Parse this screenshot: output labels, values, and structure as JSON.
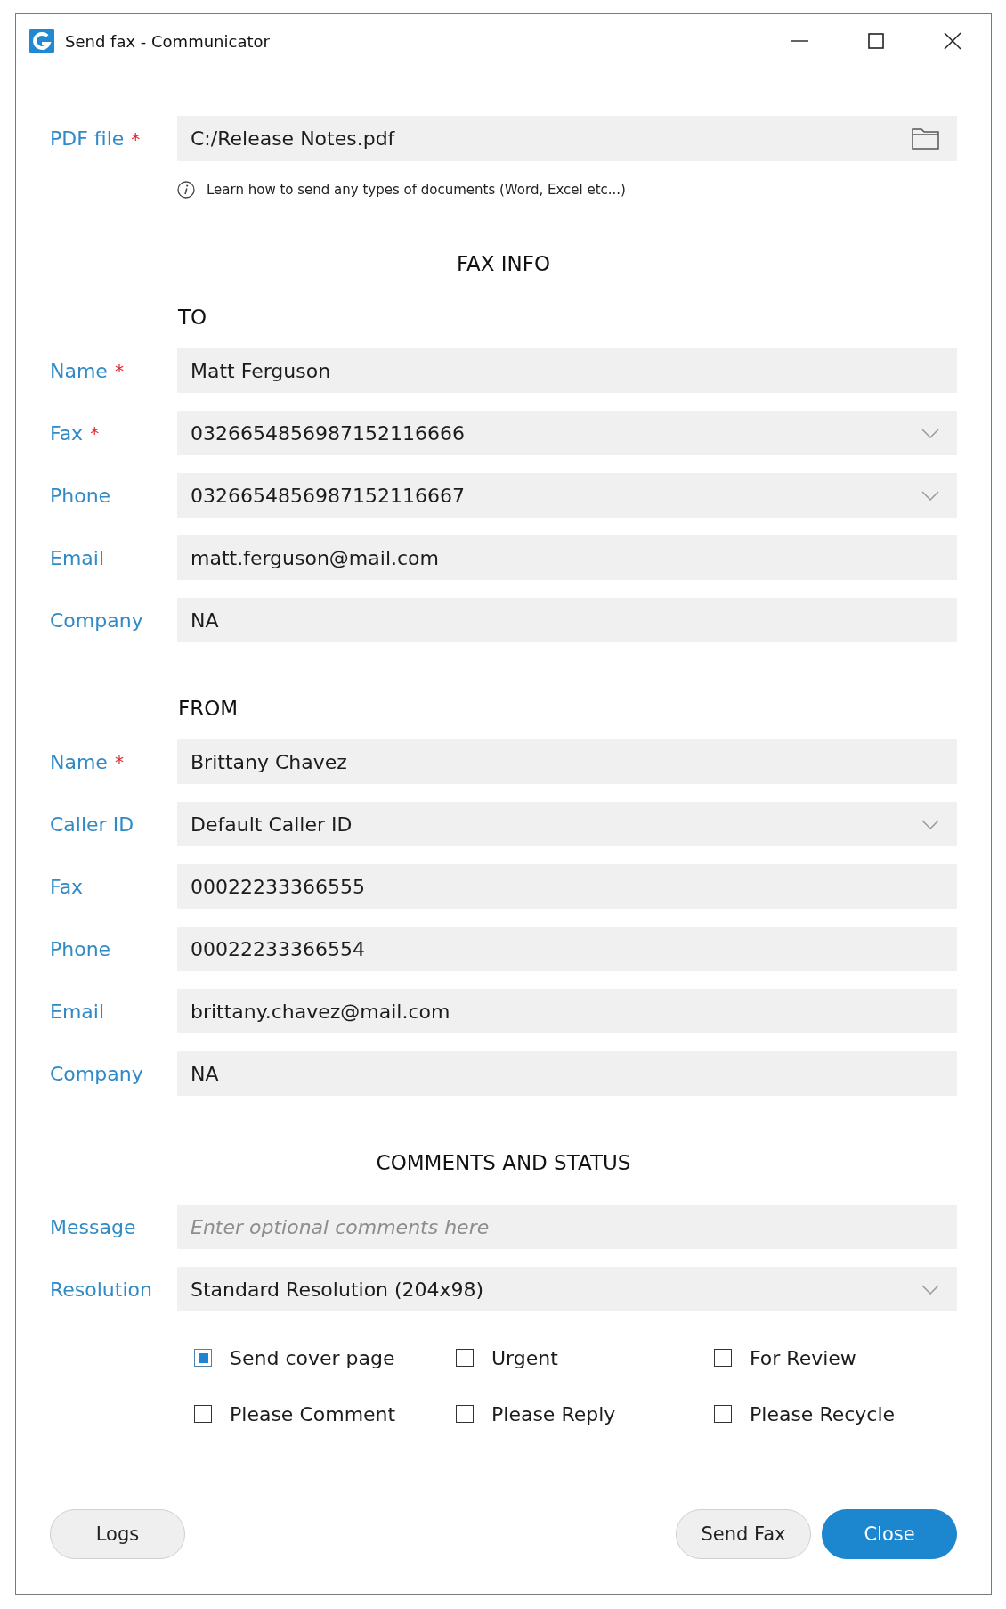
{
  "window": {
    "title": "Send fax - Communicator"
  },
  "pdf_file": {
    "label": "PDF file",
    "required_mark": "*",
    "kind": "file",
    "value": "C:/Release Notes.pdf",
    "help_text": "Learn how to send any types of documents (Word, Excel etc...)"
  },
  "fax_info": {
    "heading": "FAX INFO",
    "groups": [
      {
        "heading": "TO",
        "fields": [
          {
            "label": "Name",
            "required_mark": "*",
            "kind": "text",
            "value": "Matt Ferguson"
          },
          {
            "label": "Fax",
            "required_mark": "*",
            "kind": "dropdown",
            "value": "0326654856987152116666"
          },
          {
            "label": "Phone",
            "kind": "dropdown",
            "value": "0326654856987152116667"
          },
          {
            "label": "Email",
            "kind": "text",
            "value": "matt.ferguson@mail.com"
          },
          {
            "label": "Company",
            "kind": "text",
            "value": "NA"
          }
        ]
      },
      {
        "heading": "FROM",
        "fields": [
          {
            "label": "Name",
            "required_mark": "*",
            "kind": "text",
            "value": "Brittany Chavez"
          },
          {
            "label": "Caller ID",
            "kind": "dropdown",
            "value": "Default Caller ID"
          },
          {
            "label": "Fax",
            "kind": "text",
            "value": "00022233366555"
          },
          {
            "label": "Phone",
            "kind": "text",
            "value": "00022233366554"
          },
          {
            "label": "Email",
            "kind": "text",
            "value": "brittany.chavez@mail.com"
          },
          {
            "label": "Company",
            "kind": "text",
            "value": "NA"
          }
        ]
      }
    ]
  },
  "comments_and_status": {
    "heading": "COMMENTS AND STATUS",
    "fields": [
      {
        "label": "Message",
        "kind": "text",
        "placeholder": "Enter optional comments here"
      },
      {
        "label": "Resolution",
        "kind": "dropdown",
        "value": "Standard Resolution (204x98)"
      }
    ],
    "options": [
      {
        "label": "Send cover page",
        "checked": true
      },
      {
        "label": "Urgent",
        "checked": false
      },
      {
        "label": "For Review",
        "checked": false
      },
      {
        "label": "Please Comment",
        "checked": false
      },
      {
        "label": "Please Reply",
        "checked": false
      },
      {
        "label": "Please Recycle",
        "checked": false
      }
    ]
  },
  "buttons": [
    {
      "label": "Logs",
      "kind": "secondary"
    },
    {
      "label": "Send Fax",
      "kind": "secondary"
    },
    {
      "label": "Close",
      "kind": "primary"
    }
  ]
}
